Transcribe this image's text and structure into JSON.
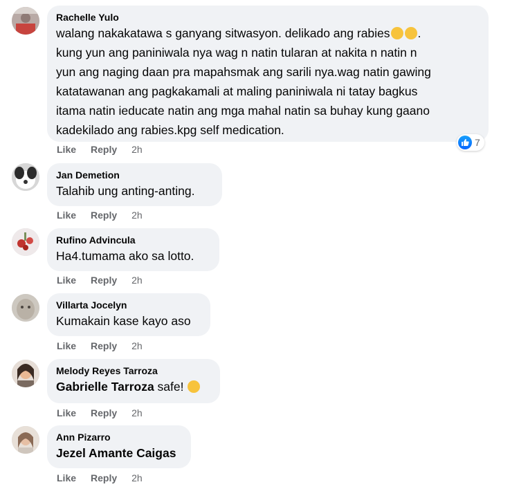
{
  "comments": [
    {
      "author": "Rachelle Yulo",
      "text_line1": "walang nakakatawa s ganyang sitwasyon. delikado ang rabies",
      "text_line1_end": ".",
      "text_rest": "kung yun ang paniniwala nya wag n natin tularan at nakita n natin n\nyun ang naging daan pra mapahsmak ang sarili nya.wag natin gawing\nkatatawanan ang pagkakamali at maling paniniwala ni tatay bagkus\nitama natin ieducate natin ang mga mahal natin sa buhay kung gaano\nkadekilado ang rabies.kpg self medication.",
      "like": "Like",
      "reply": "Reply",
      "time": "2h",
      "reaction_icon": "thumbs-up-icon",
      "reaction_count": "7"
    },
    {
      "author": "Jan Demetion",
      "text": "Talahib ung anting-anting.",
      "like": "Like",
      "reply": "Reply",
      "time": "2h"
    },
    {
      "author": "Rufino Advincula",
      "text": "Ha4.tumama ako sa lotto.",
      "like": "Like",
      "reply": "Reply",
      "time": "2h"
    },
    {
      "author": "Villarta Jocelyn",
      "text": "Kumakain kase kayo aso",
      "like": "Like",
      "reply": "Reply",
      "time": "2h"
    },
    {
      "author": "Melody Reyes Tarroza",
      "tag": "Gabrielle Tarroza",
      "text": " safe! ",
      "like": "Like",
      "reply": "Reply",
      "time": "2h"
    },
    {
      "author": "Ann Pizarro",
      "tag": "Jezel Amante Caigas",
      "like": "Like",
      "reply": "Reply",
      "time": "2h"
    }
  ],
  "colors": {
    "bubble": "#f0f2f5",
    "meta": "#65676b",
    "like_blue": "#0866ff"
  }
}
